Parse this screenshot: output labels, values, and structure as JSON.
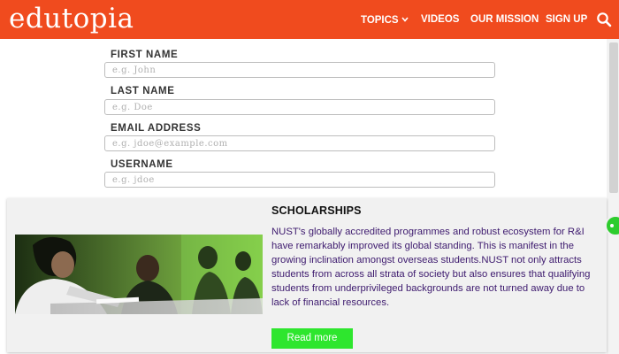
{
  "header": {
    "logo": "edutopia",
    "nav": [
      "TOPICS",
      "VIDEOS",
      "OUR MISSION",
      "SIGN UP"
    ],
    "colors": {
      "brand": "#f04b1e"
    },
    "icons": {
      "topics": "chevron-down-icon",
      "search": "search-icon"
    }
  },
  "form": {
    "fields": [
      {
        "label": "FIRST NAME",
        "placeholder": "e.g. John"
      },
      {
        "label": "LAST NAME",
        "placeholder": "e.g. Doe"
      },
      {
        "label": "EMAIL ADDRESS",
        "placeholder": "e.g. jdoe@example.com"
      },
      {
        "label": "USERNAME",
        "placeholder": "e.g. jdoe"
      }
    ]
  },
  "popup": {
    "title": "SCHOLARSHIPS",
    "body": "NUST's globally accredited programmes and robust ecosystem for R&I have remarkably improved its global standing. This is manifest in the growing inclination amongst overseas students.NUST not only attracts students from across all strata of society but also ensures that qualifying students from underprivileged backgrounds are not turned away due to lack of financial resources.",
    "button": "Read more",
    "colors": {
      "body_text": "#3d1a6e",
      "button": "#2ee62e"
    }
  }
}
